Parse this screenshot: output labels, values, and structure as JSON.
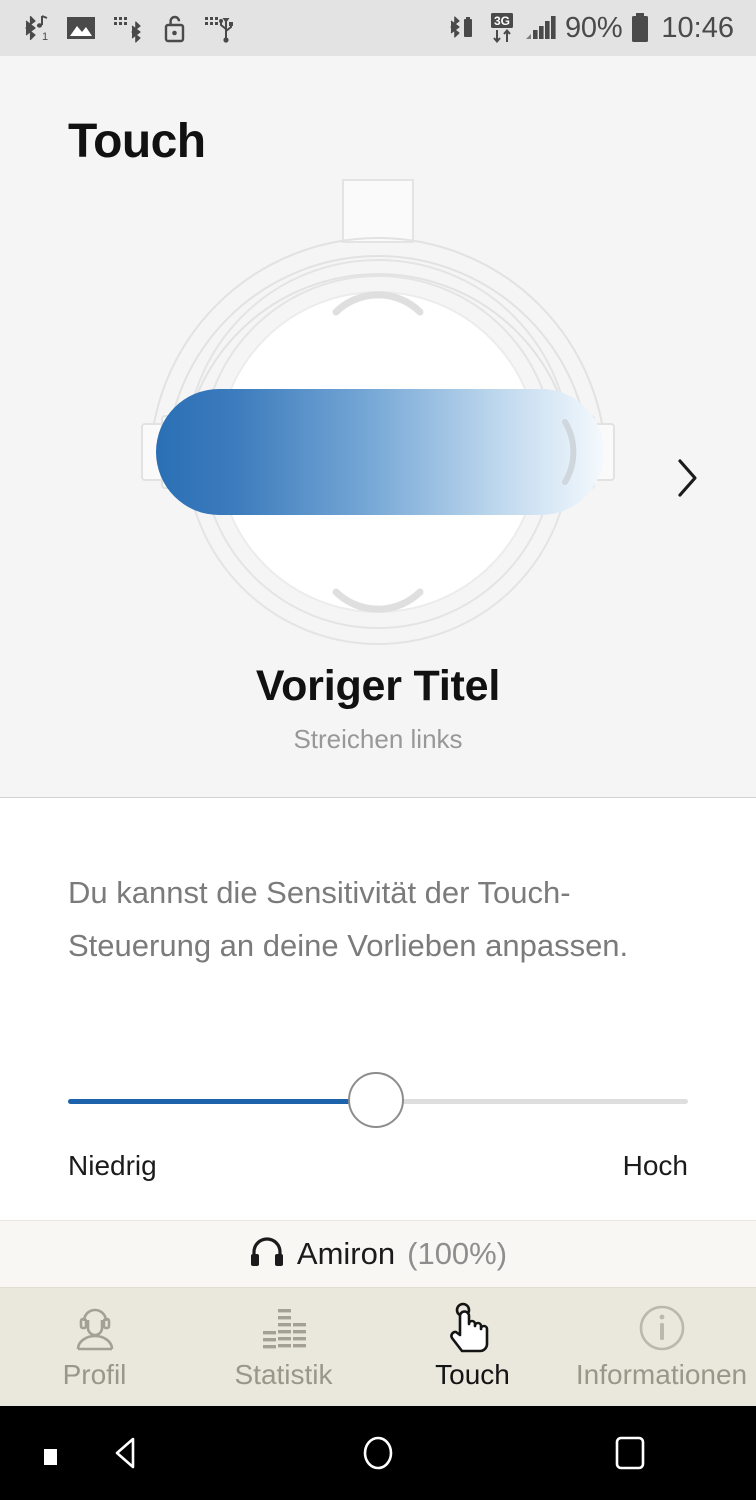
{
  "status_bar": {
    "left_icons": [
      {
        "name": "bluetooth-audio-icon",
        "glyph": "bt-music"
      },
      {
        "name": "screenshot-image-icon",
        "glyph": "image"
      },
      {
        "name": "bluetooth-transfer-icon",
        "glyph": "bt-transfer"
      },
      {
        "name": "unlock-icon",
        "glyph": "unlock"
      },
      {
        "name": "usb-icon",
        "glyph": "usb"
      }
    ],
    "right_icons": [
      {
        "name": "bluetooth-battery-icon",
        "glyph": "bt-batt"
      },
      {
        "name": "mobile-data-3g-icon",
        "glyph": "3g"
      },
      {
        "name": "signal-strength-icon",
        "glyph": "signal"
      }
    ],
    "battery_percent": "90%",
    "clock": "10:46",
    "background": "#e3e3e3",
    "foreground": "#4a4a4a"
  },
  "header": {
    "title": "Touch"
  },
  "hero": {
    "illustration_name": "headphone-earcup-swipe-left-illustration",
    "gesture_title": "Voriger Titel",
    "gesture_subtitle": "Streichen links",
    "next_arrow_glyph": "›",
    "gradient_start": "#2a6fb5",
    "gradient_end": "#f4f9fd",
    "background": "#f5f5f5",
    "outline_color": "#e2e2e2"
  },
  "settings": {
    "description": "Du kannst die Sensitivität der Touch-Steuerung an deine Vorlieben anpassen.",
    "slider": {
      "name": "sensitivity-slider",
      "value_percent": 50,
      "low_label": "Niedrig",
      "high_label": "Hoch",
      "fill_color": "#1d63ab",
      "track_color": "#dedede"
    }
  },
  "device_bar": {
    "icon": "headphones-icon",
    "device_name": "Amiron",
    "battery": "(100%)"
  },
  "tabs": [
    {
      "label": "Profil",
      "icon": "profile-headset-icon",
      "active": false
    },
    {
      "label": "Statistik",
      "icon": "equalizer-bars-icon",
      "active": false
    },
    {
      "label": "Touch",
      "icon": "hand-tap-icon",
      "active": true
    },
    {
      "label": "Informationen",
      "icon": "info-circle-icon",
      "active": false
    }
  ],
  "android_nav": {
    "background": "#000000",
    "buttons": [
      {
        "name": "back-button",
        "icon": "triangle-left-icon"
      },
      {
        "name": "home-button",
        "icon": "circle-icon"
      },
      {
        "name": "recents-button",
        "icon": "square-icon"
      }
    ]
  }
}
